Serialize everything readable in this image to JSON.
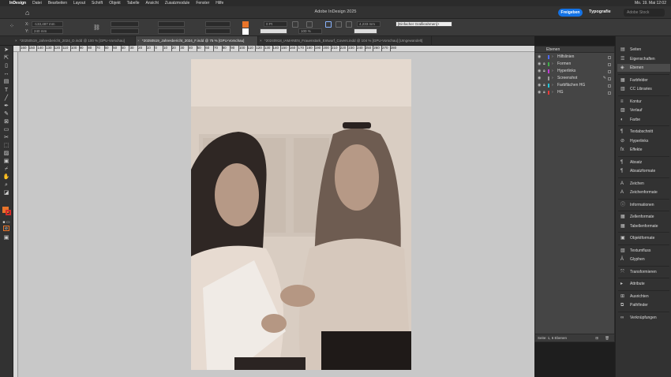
{
  "menubar": {
    "items": [
      "InDesign",
      "Datei",
      "Bearbeiten",
      "Layout",
      "Schrift",
      "Objekt",
      "Tabelle",
      "Ansicht",
      "Zusatzmodule",
      "Fenster",
      "Hilfe"
    ],
    "clock": "Mo. 19. Mai 12:02"
  },
  "appbar": {
    "title": "Adobe InDesign 2025",
    "share_label": "Freigeben",
    "workspace_label": "Typografie",
    "search_placeholder": "Adobe Stock"
  },
  "controlbar": {
    "x_value": "-133,487 mm",
    "y_value": "240 mm",
    "stroke_weight": "0 Pt",
    "zoom_percent": "100 %",
    "frame_size": "4,233 mm",
    "object_style": "[Einfacher Grafikrahmen]+"
  },
  "tabs": [
    {
      "label": "*20250519_Jahresbericht_2024_D.indd @ 100 % [GPU-Vorschau]",
      "active": false
    },
    {
      "label": "*20250519_Jahresbericht_2024_F.indd @ 75 % [GPU-Vorschau]",
      "active": true
    },
    {
      "label": "*20240918_IAMANEN_Frauenstark_Entwurf_Covers.indd @ 104 % [GPU-Vorschau] [Umgewandelt]",
      "active": false
    }
  ],
  "ruler": {
    "labels": [
      "160",
      "150",
      "140",
      "130",
      "120",
      "110",
      "100",
      "90",
      "80",
      "70",
      "60",
      "50",
      "40",
      "30",
      "20",
      "10",
      "0",
      "10",
      "20",
      "30",
      "40",
      "50",
      "60",
      "70",
      "80",
      "90",
      "100",
      "110",
      "120",
      "130",
      "140",
      "150",
      "160",
      "170",
      "180",
      "190",
      "200",
      "210",
      "220",
      "230",
      "240",
      "250",
      "260",
      "270",
      "280"
    ]
  },
  "layers_panel": {
    "title": "Ebenen",
    "layers": [
      {
        "name": "Hilfslinien",
        "color": "#4f6bff"
      },
      {
        "name": "Formen",
        "color": "#3fae49"
      },
      {
        "name": "Hyperlinks",
        "color": "#c13bd6"
      },
      {
        "name": "Screenshot",
        "color": "#9a9a9a"
      },
      {
        "name": "Farbflächen HG",
        "color": "#22c4d8"
      },
      {
        "name": "HG",
        "color": "#e83a3a"
      }
    ],
    "footer": "Seite: 1, 6 Ebenen"
  },
  "dock": {
    "items": [
      {
        "label": "Seiten",
        "icon": "pages-icon",
        "glyph": "▤"
      },
      {
        "label": "Eigenschaften",
        "icon": "properties-icon",
        "glyph": "☰"
      },
      {
        "label": "Ebenen",
        "icon": "layers-icon",
        "glyph": "◈",
        "active": true
      },
      {
        "label": "Farbfelder",
        "icon": "swatches-icon",
        "glyph": "▦"
      },
      {
        "label": "CC Libraries",
        "icon": "libraries-icon",
        "glyph": "▥"
      },
      {
        "label": "Kontur",
        "icon": "stroke-icon",
        "glyph": "≡"
      },
      {
        "label": "Verlauf",
        "icon": "gradient-icon",
        "glyph": "▨"
      },
      {
        "label": "Farbe",
        "icon": "color-icon",
        "glyph": "◐"
      },
      {
        "label": "Textabschnitt",
        "icon": "story-icon",
        "glyph": "¶"
      },
      {
        "label": "Hyperlinks",
        "icon": "hyperlinks-icon",
        "glyph": "⊘"
      },
      {
        "label": "Effekte",
        "icon": "effects-icon",
        "glyph": "fx"
      },
      {
        "label": "Absatz",
        "icon": "paragraph-icon",
        "glyph": "¶"
      },
      {
        "label": "Absatzformate",
        "icon": "paragraph-styles-icon",
        "glyph": "¶"
      },
      {
        "label": "Zeichen",
        "icon": "character-icon",
        "glyph": "A"
      },
      {
        "label": "Zeichenformate",
        "icon": "character-styles-icon",
        "glyph": "A"
      },
      {
        "label": "Informationen",
        "icon": "info-icon",
        "glyph": "ⓘ"
      },
      {
        "label": "Zellenformate",
        "icon": "cell-styles-icon",
        "glyph": "▦"
      },
      {
        "label": "Tabellenformate",
        "icon": "table-styles-icon",
        "glyph": "▦"
      },
      {
        "label": "Objektformate",
        "icon": "object-styles-icon",
        "glyph": "▣"
      },
      {
        "label": "Textumfluss",
        "icon": "text-wrap-icon",
        "glyph": "▧"
      },
      {
        "label": "Glyphen",
        "icon": "glyphs-icon",
        "glyph": "Ä"
      },
      {
        "label": "Transformieren",
        "icon": "transform-icon",
        "glyph": "⤧"
      },
      {
        "label": "Attribute",
        "icon": "attributes-icon",
        "glyph": "▸"
      },
      {
        "label": "Ausrichten",
        "icon": "align-icon",
        "glyph": "⊞"
      },
      {
        "label": "Pathfinder",
        "icon": "pathfinder-icon",
        "glyph": "⧉"
      },
      {
        "label": "Verknüpfungen",
        "icon": "links-icon",
        "glyph": "∞"
      }
    ]
  },
  "colors": {
    "accent": "#1473e6",
    "fill_swatch": "#e8742a",
    "stroke_swatch": "#d62b2b",
    "pasteboard": "#c8c8c8"
  }
}
